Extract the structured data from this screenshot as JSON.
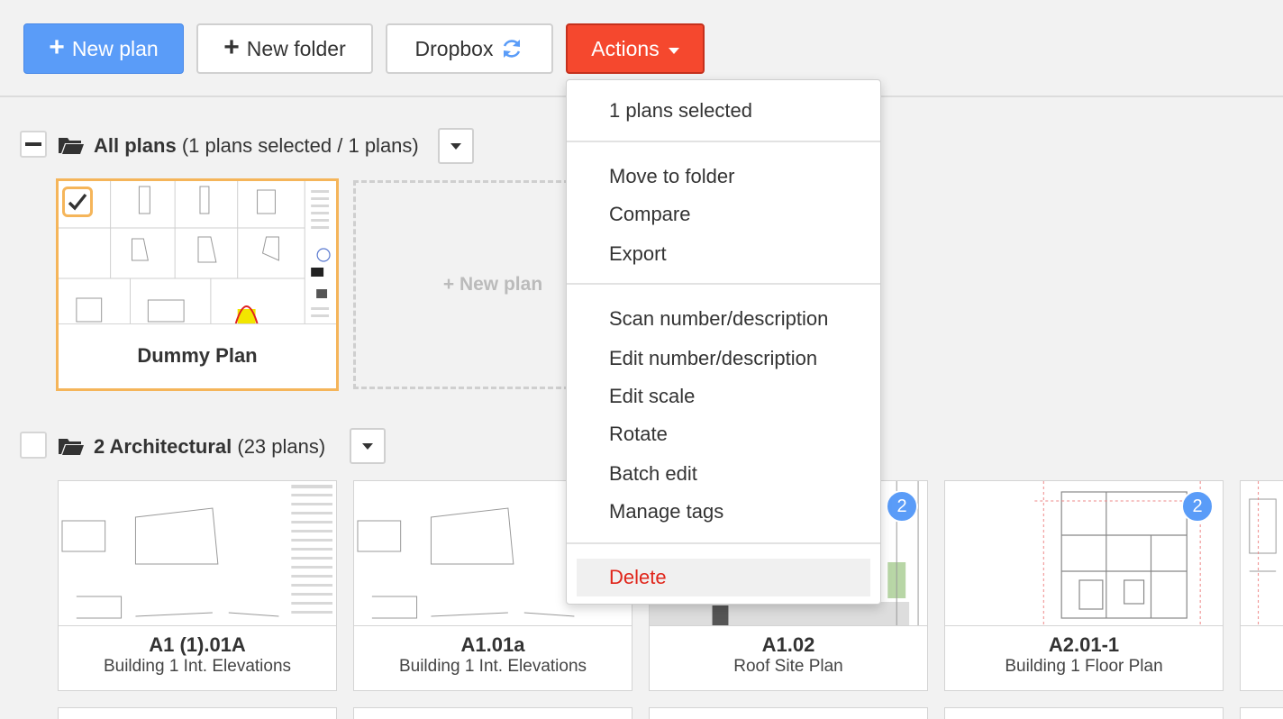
{
  "toolbar": {
    "new_plan": "New plan",
    "new_folder": "New folder",
    "dropbox": "Dropbox",
    "actions": "Actions"
  },
  "groups": [
    {
      "name": "All plans",
      "meta": "(1 plans selected / 1 plans)",
      "state": "partial",
      "plans": [
        {
          "title": "Dummy Plan",
          "subtitle": "",
          "selected": true
        }
      ],
      "new_plan_label": "+ New plan"
    },
    {
      "name": "2 Architectural",
      "meta": "(23 plans)",
      "state": "unchecked",
      "plans": [
        {
          "title": "A1 (1).01A",
          "subtitle": "Building 1 Int. Elevations",
          "badge": ""
        },
        {
          "title": "A1.01a",
          "subtitle": "Building 1 Int. Elevations",
          "badge": ""
        },
        {
          "title": "A1.02",
          "subtitle": "Roof Site Plan",
          "badge": "2"
        },
        {
          "title": "A2.01-1",
          "subtitle": "Building 1 Floor Plan",
          "badge": "2"
        }
      ]
    }
  ],
  "actions_menu": {
    "header": "1 plans selected",
    "section1": [
      "Move to folder",
      "Compare",
      "Export"
    ],
    "section2": [
      "Scan number/description",
      "Edit number/description",
      "Edit scale",
      "Rotate",
      "Batch edit",
      "Manage tags"
    ],
    "delete": "Delete"
  },
  "colors": {
    "primary": "#5a9cf8",
    "danger": "#f5482e",
    "selected_border": "#f5b55a",
    "delete_text": "#e0261b"
  },
  "icons": {
    "new_plan": "plus-icon",
    "new_folder": "plus-icon",
    "dropbox": "sync-icon",
    "actions": "caret-down-icon",
    "group": "folder-open-icon"
  }
}
